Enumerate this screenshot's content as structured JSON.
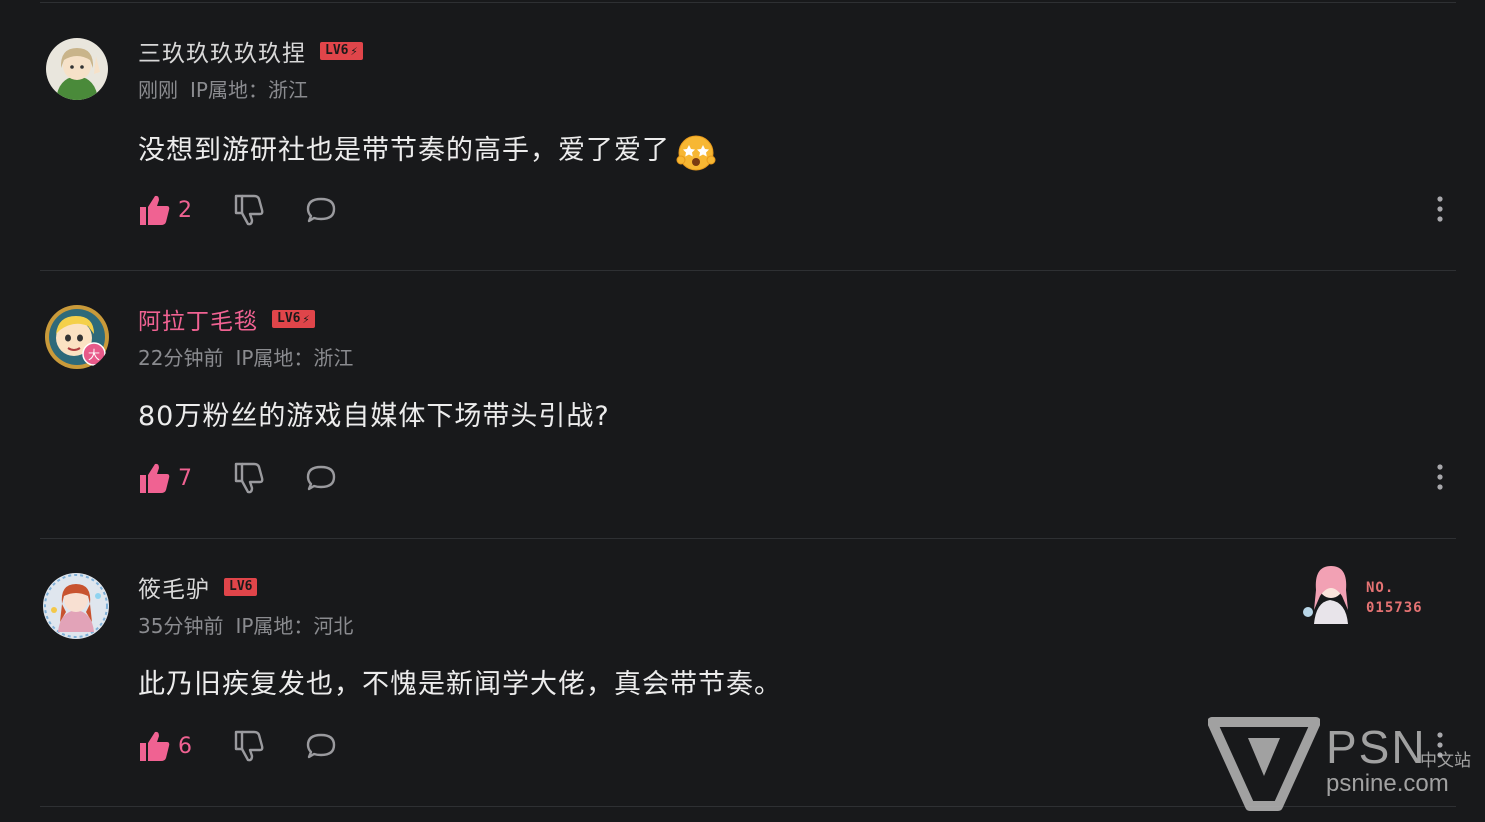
{
  "comments": [
    {
      "username": "三玖玖玖玖玖捏",
      "level": "LV6",
      "time": "刚刚",
      "ip_label": "IP属地：浙江",
      "text": "没想到游研社也是带节奏的高手，爱了爱了",
      "emoji": "star-eyes-emoji",
      "likes": "2",
      "vip": false
    },
    {
      "username": "阿拉丁毛毯",
      "level": "LV6",
      "time": "22分钟前",
      "ip_label": "IP属地：浙江",
      "text": "80万粉丝的游戏自媒体下场带头引战?",
      "likes": "7",
      "vip": true,
      "avatar_badge": "大"
    },
    {
      "username": "筱毛驴",
      "level": "LV6",
      "time": "35分钟前",
      "ip_label": "IP属地：河北",
      "text": "此乃旧疾复发也，不愧是新闻学大佬，真会带节奏。",
      "likes": "6",
      "vip": false,
      "fan_badge": {
        "line1": "NO.",
        "line2": "015736"
      }
    }
  ],
  "watermark": {
    "brand": "PSN",
    "subtitle": "中文站",
    "url": "psnine.com"
  },
  "colors": {
    "background": "#18191b",
    "accent": "#f06292",
    "level_badge": "#e0454a",
    "muted": "#8a8b8f"
  }
}
